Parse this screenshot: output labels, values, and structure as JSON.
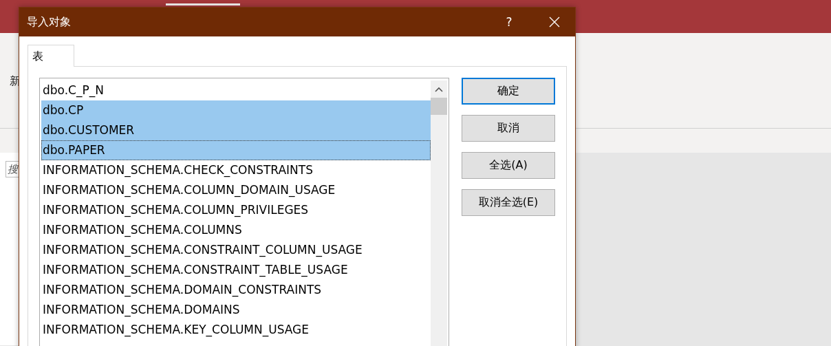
{
  "background_app": {
    "ribbon_label": "新",
    "search_placeholder": "搜"
  },
  "dialog": {
    "title": "导入对象",
    "help": "?",
    "tabs": [
      {
        "label": "表",
        "selected": true
      }
    ],
    "objects": [
      {
        "name": "dbo.C_P_N",
        "selected": false,
        "focused": false
      },
      {
        "name": "dbo.CP",
        "selected": true,
        "focused": false
      },
      {
        "name": "dbo.CUSTOMER",
        "selected": true,
        "focused": false
      },
      {
        "name": "dbo.PAPER",
        "selected": true,
        "focused": true
      },
      {
        "name": "INFORMATION_SCHEMA.CHECK_CONSTRAINTS",
        "selected": false,
        "focused": false
      },
      {
        "name": "INFORMATION_SCHEMA.COLUMN_DOMAIN_USAGE",
        "selected": false,
        "focused": false
      },
      {
        "name": "INFORMATION_SCHEMA.COLUMN_PRIVILEGES",
        "selected": false,
        "focused": false
      },
      {
        "name": "INFORMATION_SCHEMA.COLUMNS",
        "selected": false,
        "focused": false
      },
      {
        "name": "INFORMATION_SCHEMA.CONSTRAINT_COLUMN_USAGE",
        "selected": false,
        "focused": false
      },
      {
        "name": "INFORMATION_SCHEMA.CONSTRAINT_TABLE_USAGE",
        "selected": false,
        "focused": false
      },
      {
        "name": "INFORMATION_SCHEMA.DOMAIN_CONSTRAINTS",
        "selected": false,
        "focused": false
      },
      {
        "name": "INFORMATION_SCHEMA.DOMAINS",
        "selected": false,
        "focused": false
      },
      {
        "name": "INFORMATION_SCHEMA.KEY_COLUMN_USAGE",
        "selected": false,
        "focused": false
      }
    ],
    "buttons": [
      {
        "label": "确定",
        "default": true
      },
      {
        "label": "取消",
        "default": false
      },
      {
        "label": "全选(A)",
        "default": false
      },
      {
        "label": "取消全选(E)",
        "default": false
      }
    ]
  }
}
